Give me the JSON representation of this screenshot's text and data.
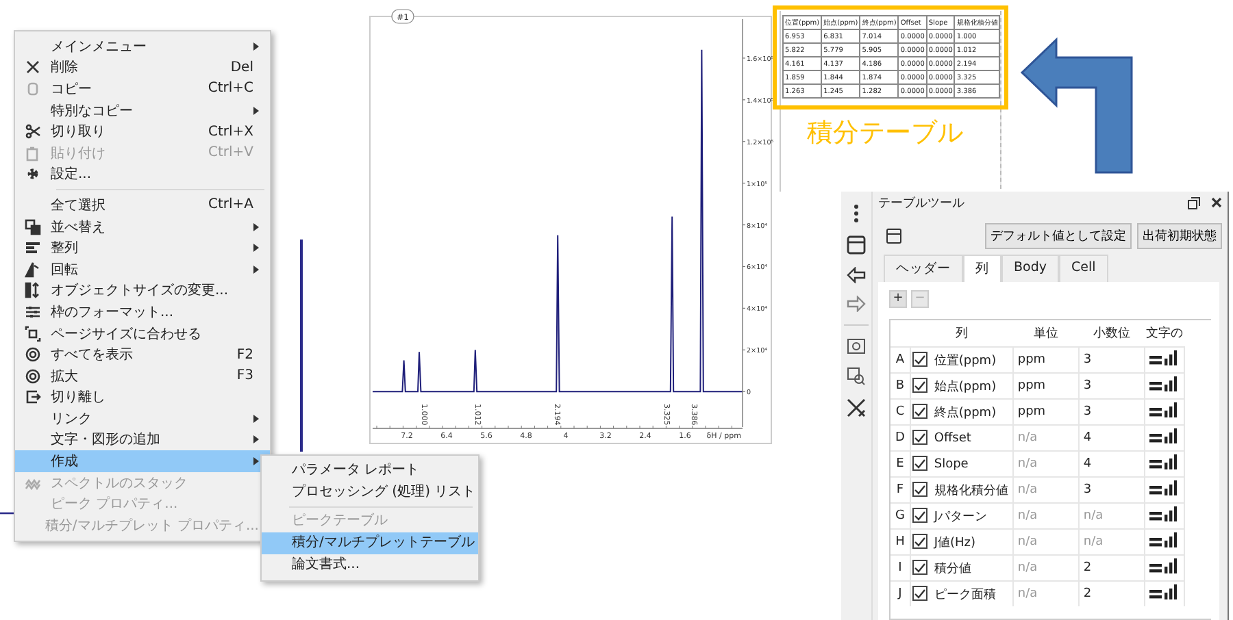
{
  "context_menu": {
    "items": [
      {
        "kind": "item",
        "label": "メインメニュー",
        "submenu": true,
        "disabled": false,
        "selected": false
      },
      {
        "kind": "item",
        "label": "削除",
        "shortcut": "Del",
        "submenu": false,
        "disabled": false,
        "selected": false
      },
      {
        "kind": "item",
        "label": "コピー",
        "shortcut": "Ctrl+C",
        "submenu": false,
        "disabled": false,
        "selected": false
      },
      {
        "kind": "item",
        "label": "特別なコピー",
        "submenu": true,
        "disabled": false,
        "selected": false
      },
      {
        "kind": "item",
        "label": "切り取り",
        "shortcut": "Ctrl+X",
        "submenu": false,
        "disabled": false,
        "selected": false
      },
      {
        "kind": "item",
        "label": "貼り付け",
        "shortcut": "Ctrl+V",
        "submenu": false,
        "disabled": true,
        "selected": false
      },
      {
        "kind": "item",
        "label": "設定...",
        "submenu": false,
        "disabled": false,
        "selected": false
      },
      {
        "kind": "separator"
      },
      {
        "kind": "item",
        "label": "全て選択",
        "shortcut": "Ctrl+A",
        "submenu": false,
        "disabled": false,
        "selected": false
      },
      {
        "kind": "item",
        "label": "並べ替え",
        "submenu": true,
        "disabled": false,
        "selected": false
      },
      {
        "kind": "item",
        "label": "整列",
        "submenu": true,
        "disabled": false,
        "selected": false
      },
      {
        "kind": "item",
        "label": "回転",
        "submenu": true,
        "disabled": false,
        "selected": false
      },
      {
        "kind": "item",
        "label": "オブジェクトサイズの変更...",
        "submenu": false,
        "disabled": false,
        "selected": false
      },
      {
        "kind": "item",
        "label": "枠のフォーマット...",
        "submenu": false,
        "disabled": false,
        "selected": false
      },
      {
        "kind": "item",
        "label": "ページサイズに合わせる",
        "submenu": false,
        "disabled": false,
        "selected": false
      },
      {
        "kind": "item",
        "label": "すべてを表示",
        "shortcut": "F2",
        "submenu": false,
        "disabled": false,
        "selected": false
      },
      {
        "kind": "item",
        "label": "拡大",
        "shortcut": "F3",
        "submenu": false,
        "disabled": false,
        "selected": false
      },
      {
        "kind": "item",
        "label": "切り離し",
        "submenu": false,
        "disabled": false,
        "selected": false
      },
      {
        "kind": "item",
        "label": "リンク",
        "submenu": true,
        "disabled": false,
        "selected": false
      },
      {
        "kind": "item",
        "label": "文字・図形の追加",
        "submenu": true,
        "disabled": false,
        "selected": false
      },
      {
        "kind": "item",
        "label": "作成",
        "submenu": true,
        "disabled": false,
        "selected": true
      },
      {
        "kind": "item",
        "label": "スペクトルのスタック",
        "submenu": false,
        "disabled": true,
        "selected": false
      },
      {
        "kind": "item",
        "label": "ピーク プロパティ...",
        "submenu": false,
        "disabled": true,
        "selected": false
      },
      {
        "kind": "item",
        "label": "積分/マルチプレット プロパティ...",
        "submenu": false,
        "disabled": true,
        "selected": false
      }
    ]
  },
  "submenu": {
    "items": [
      {
        "kind": "item",
        "label": "パラメータ レポート",
        "disabled": false,
        "selected": false
      },
      {
        "kind": "item",
        "label": "プロセッシング (処理) リスト",
        "disabled": false,
        "selected": false
      },
      {
        "kind": "separator"
      },
      {
        "kind": "item",
        "label": "ピークテーブル",
        "disabled": true,
        "selected": false
      },
      {
        "kind": "item",
        "label": "積分/マルチプレットテーブル",
        "disabled": false,
        "selected": true
      },
      {
        "kind": "item",
        "label": "論文書式...",
        "disabled": false,
        "selected": false
      }
    ]
  },
  "spectrum": {
    "badge": "#1",
    "chart_data": {
      "type": "line",
      "xlabel": "δH / ppm",
      "x": [
        7.89,
        7.29,
        7.26,
        7.23,
        6.98,
        6.953,
        6.92,
        5.85,
        5.822,
        5.79,
        4.19,
        4.161,
        4.13,
        1.89,
        1.859,
        1.83,
        1.29,
        1.263,
        1.23,
        0.44
      ],
      "series": [
        {
          "color": "#1f1f7a",
          "values": [
            0,
            0,
            15000,
            0,
            0,
            19000,
            0,
            0,
            20000,
            0,
            0,
            75000,
            0,
            0,
            84000,
            0,
            0,
            164000,
            0,
            0
          ]
        }
      ],
      "xlim": [
        7.89,
        0.44
      ],
      "ylim": [
        -17000,
        180000
      ],
      "xticks": [
        7.2,
        6.4,
        5.6,
        4.8,
        4,
        3.2,
        2.4,
        1.6
      ],
      "yticks": [
        {
          "value": 160000,
          "label": "1.6×10⁵"
        },
        {
          "value": 140000,
          "label": "1.4×10⁵"
        },
        {
          "value": 120000,
          "label": "1.2×10⁵"
        },
        {
          "value": 100000,
          "label": "1×10⁵"
        },
        {
          "value": 80000,
          "label": "8×10⁴"
        },
        {
          "value": 60000,
          "label": "6×10⁴"
        },
        {
          "value": 40000,
          "label": "4×10⁴"
        },
        {
          "value": 20000,
          "label": "2×10⁴"
        },
        {
          "value": 0,
          "label": "0"
        }
      ]
    },
    "integrals": [
      "1.000",
      "1.012",
      "2.194",
      "3.325",
      "3.386"
    ]
  },
  "integral_table": {
    "columns": [
      "位置(ppm)",
      "始点(ppm)",
      "終点(ppm)",
      "Offset",
      "Slope",
      "規格化積分値"
    ],
    "rows": [
      [
        "6.953",
        "6.831",
        "7.014",
        "0.0000",
        "0.0000",
        "1.000"
      ],
      [
        "5.822",
        "5.779",
        "5.905",
        "0.0000",
        "0.0000",
        "1.012"
      ],
      [
        "4.161",
        "4.137",
        "4.186",
        "0.0000",
        "0.0000",
        "2.194"
      ],
      [
        "1.859",
        "1.844",
        "1.874",
        "0.0000",
        "0.0000",
        "3.325"
      ],
      [
        "1.263",
        "1.245",
        "1.282",
        "0.0000",
        "0.0000",
        "3.386"
      ]
    ],
    "caption": "積分テーブル"
  },
  "table_tool": {
    "title": "テーブルツール",
    "buttons": [
      "デフォルト値として設定",
      "出荷初期状態"
    ],
    "tabs": [
      {
        "label": "ヘッダー",
        "selected": false
      },
      {
        "label": "列",
        "selected": true
      },
      {
        "label": "Body",
        "selected": false
      },
      {
        "label": "Cell",
        "selected": false
      }
    ],
    "add_button": {
      "label": "+",
      "disabled": false
    },
    "remove_button": {
      "label": "−",
      "disabled": true
    },
    "headers": [
      "列",
      "単位",
      "小数位",
      "文字の"
    ],
    "rows": [
      {
        "letter": "A",
        "checked": true,
        "name": "位置(ppm)",
        "unit": "ppm",
        "unit_disabled": false,
        "decimals": "3",
        "decimals_disabled": false
      },
      {
        "letter": "B",
        "checked": true,
        "name": "始点(ppm)",
        "unit": "ppm",
        "unit_disabled": false,
        "decimals": "3",
        "decimals_disabled": false
      },
      {
        "letter": "C",
        "checked": true,
        "name": "終点(ppm)",
        "unit": "ppm",
        "unit_disabled": false,
        "decimals": "3",
        "decimals_disabled": false
      },
      {
        "letter": "D",
        "checked": true,
        "name": "Offset",
        "unit": "n/a",
        "unit_disabled": true,
        "decimals": "4",
        "decimals_disabled": false
      },
      {
        "letter": "E",
        "checked": true,
        "name": "Slope",
        "unit": "n/a",
        "unit_disabled": true,
        "decimals": "4",
        "decimals_disabled": false
      },
      {
        "letter": "F",
        "checked": true,
        "name": "規格化積分値",
        "unit": "n/a",
        "unit_disabled": true,
        "decimals": "3",
        "decimals_disabled": false
      },
      {
        "letter": "G",
        "checked": true,
        "name": "Jパターン",
        "unit": "n/a",
        "unit_disabled": true,
        "decimals": "n/a",
        "decimals_disabled": true
      },
      {
        "letter": "H",
        "checked": true,
        "name": "J値(Hz)",
        "unit": "n/a",
        "unit_disabled": true,
        "decimals": "n/a",
        "decimals_disabled": true
      },
      {
        "letter": "I",
        "checked": true,
        "name": "積分値",
        "unit": "n/a",
        "unit_disabled": true,
        "decimals": "2",
        "decimals_disabled": false
      },
      {
        "letter": "J",
        "checked": true,
        "name": "ピーク面積",
        "unit": "n/a",
        "unit_disabled": true,
        "decimals": "2",
        "decimals_disabled": false
      }
    ]
  }
}
